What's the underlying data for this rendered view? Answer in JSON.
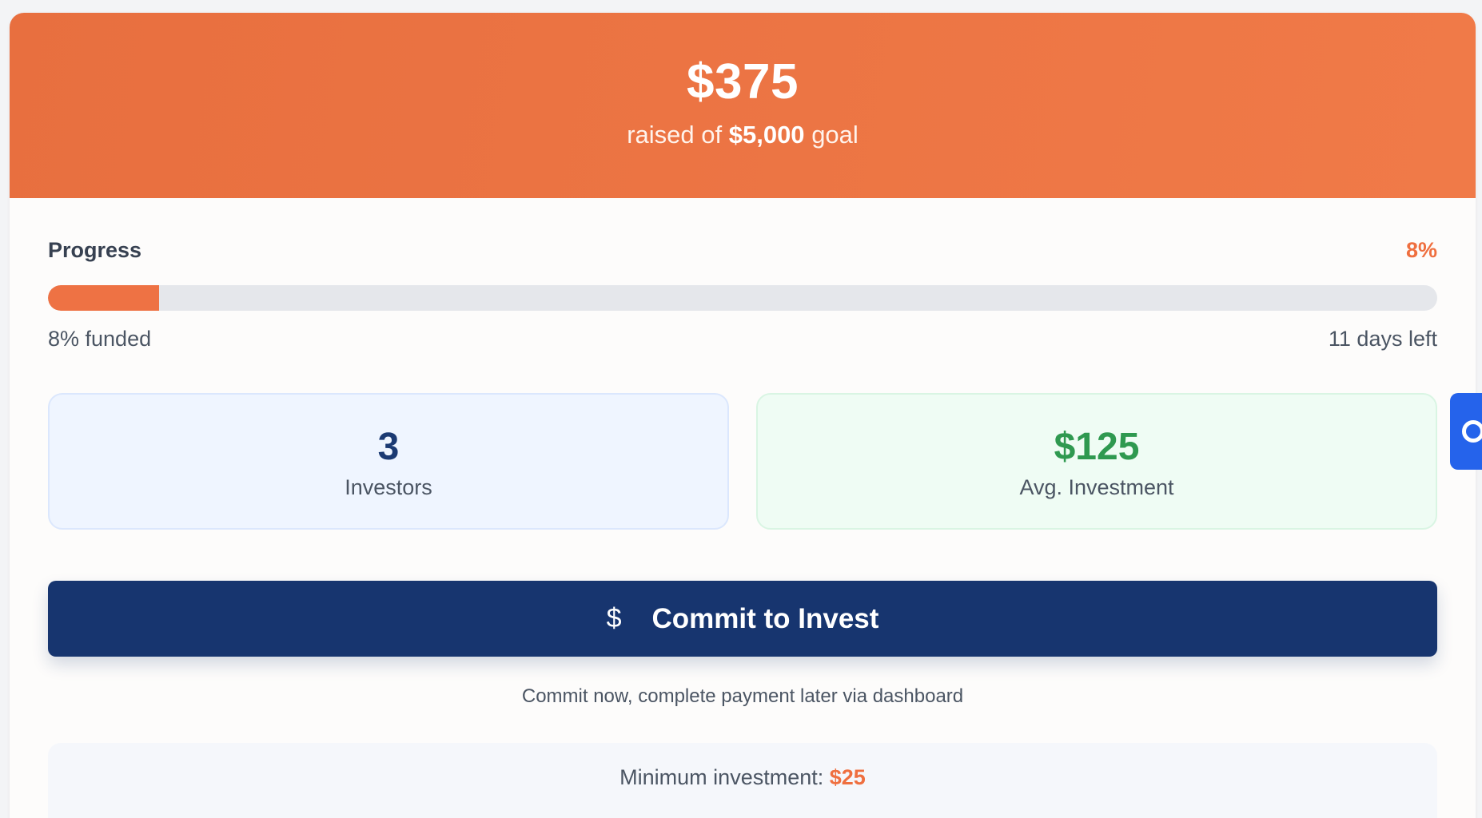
{
  "hero": {
    "amount_raised": "$375",
    "subtitle_prefix": "raised of",
    "goal_amount": "$5,000",
    "subtitle_suffix": "goal"
  },
  "progress": {
    "title": "Progress",
    "percent_label": "8%",
    "percent_value": 8,
    "funded_text": "8% funded",
    "days_left_text": "11 days left"
  },
  "stats": [
    {
      "value": "3",
      "label": "Investors"
    },
    {
      "value": "$125",
      "label": "Avg. Investment"
    }
  ],
  "cta": {
    "icon": "dollar-sign-icon",
    "icon_glyph": "$",
    "label": "Commit to Invest",
    "note": "Commit now, complete payment later via dashboard"
  },
  "minimum": {
    "label": "Minimum investment:",
    "value": "$25"
  },
  "side_tab": {
    "icon": "circle-icon"
  },
  "colors": {
    "accent_orange": "#ee7244",
    "primary_navy": "#17356f",
    "success_green": "#2f9950",
    "side_tab_blue": "#2563eb"
  }
}
